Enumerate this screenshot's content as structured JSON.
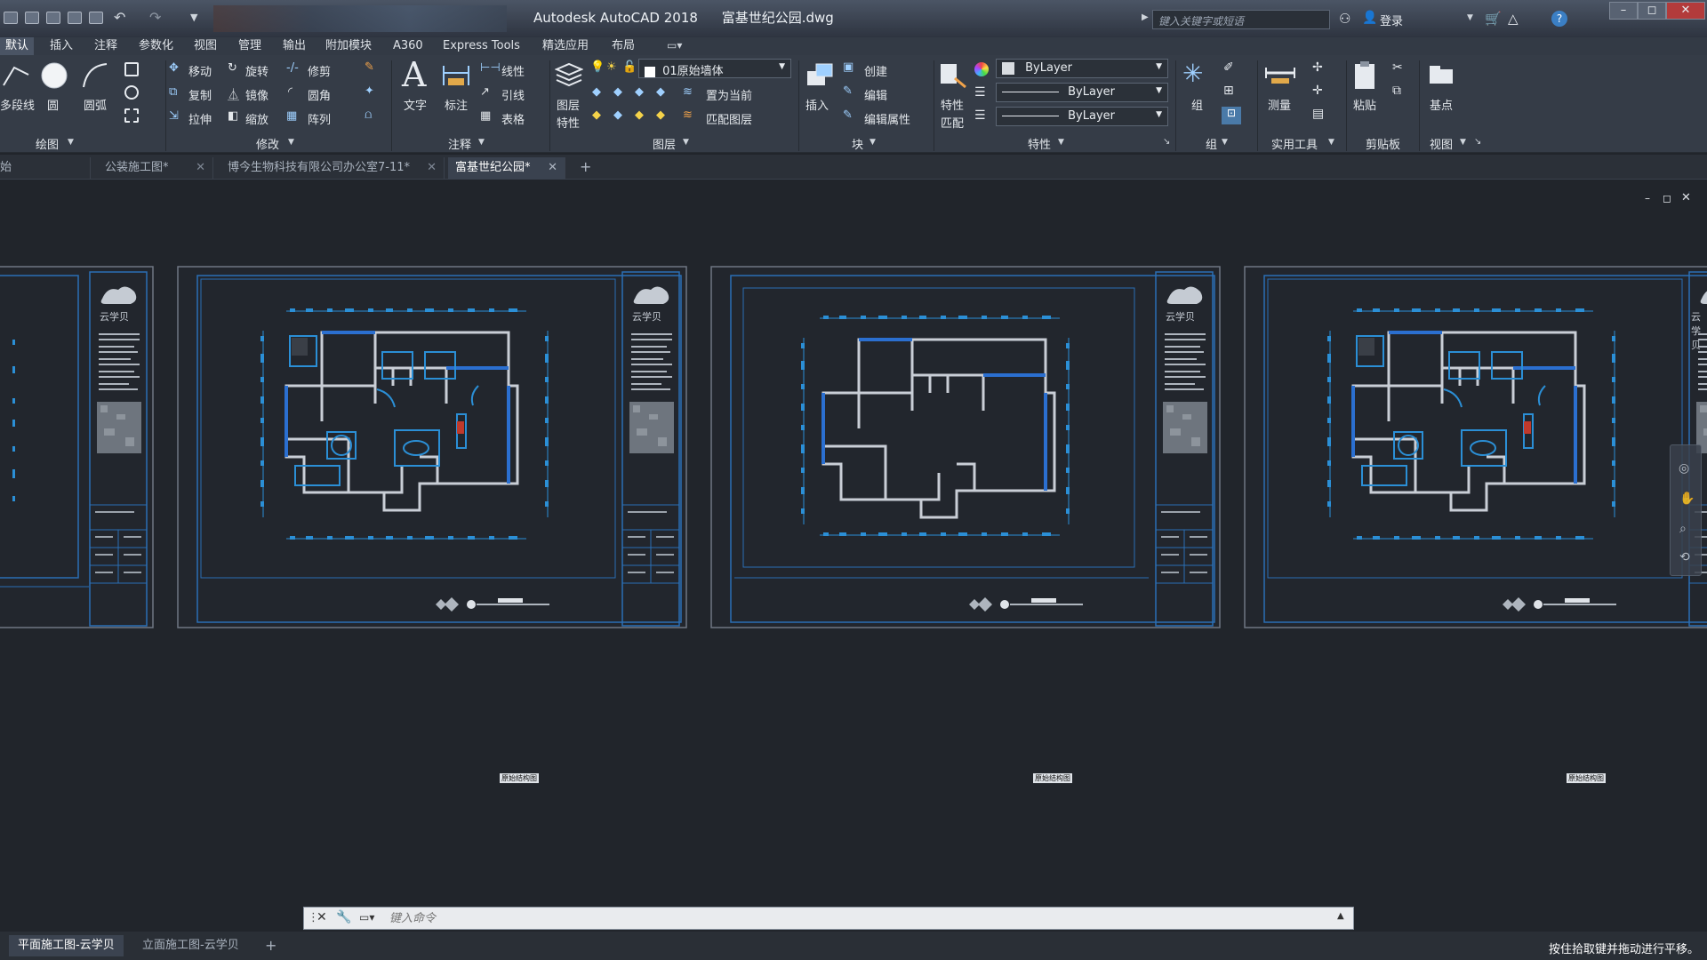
{
  "title_bar": {
    "app_title": "Autodesk AutoCAD 2018",
    "file_name": "富基世纪公园.dwg",
    "search_placeholder": "键入关键字或短语",
    "login_label": "登录"
  },
  "ribbon_tabs": [
    {
      "label": "默认",
      "active": true
    },
    {
      "label": "插入",
      "active": false
    },
    {
      "label": "注释",
      "active": false
    },
    {
      "label": "参数化",
      "active": false
    },
    {
      "label": "视图",
      "active": false
    },
    {
      "label": "管理",
      "active": false
    },
    {
      "label": "输出",
      "active": false
    },
    {
      "label": "附加模块",
      "active": false
    },
    {
      "label": "A360",
      "active": false
    },
    {
      "label": "Express Tools",
      "active": false
    },
    {
      "label": "精选应用",
      "active": false
    },
    {
      "label": "布局",
      "active": false
    }
  ],
  "ribbon": {
    "draw": {
      "polyline": "多段线",
      "circle": "圆",
      "arc": "圆弧",
      "panel": "绘图"
    },
    "modify": {
      "move": "移动",
      "rotate": "旋转",
      "trim": "修剪",
      "copy": "复制",
      "mirror": "镜像",
      "fillet": "圆角",
      "stretch": "拉伸",
      "scale": "缩放",
      "array": "阵列",
      "panel": "修改"
    },
    "annotation": {
      "text": "文字",
      "dimension": "标注",
      "linear": "线性",
      "leader": "引线",
      "table": "表格",
      "panel": "注释"
    },
    "layers": {
      "layer_props_1": "图层",
      "layer_props_2": "特性",
      "current_layer": "01原始墙体",
      "set_current": "置为当前",
      "match_layer": "匹配图层",
      "panel": "图层"
    },
    "block": {
      "insert": "插入",
      "create": "创建",
      "edit": "编辑",
      "edit_attr": "编辑属性",
      "panel": "块"
    },
    "properties": {
      "match_1": "特性",
      "match_2": "匹配",
      "color": "ByLayer",
      "linetype": "ByLayer",
      "lineweight": "ByLayer",
      "panel": "特性"
    },
    "groups": {
      "group": "组",
      "panel": "组"
    },
    "utilities": {
      "measure": "测量",
      "panel": "实用工具"
    },
    "clipboard": {
      "paste": "粘贴",
      "panel": "剪贴板"
    },
    "view": {
      "base": "基点",
      "panel": "视图"
    }
  },
  "doc_tabs": [
    {
      "label": "始",
      "active": false
    },
    {
      "label": "公装施工图*",
      "active": false
    },
    {
      "label": "博今生物科技有限公司办公室7-11*",
      "active": false
    },
    {
      "label": "富基世纪公园*",
      "active": true
    }
  ],
  "sheets": {
    "logo_text": "云学贝",
    "title_label": "原始结构图",
    "brand": "云学贝"
  },
  "command_line": {
    "placeholder": "键入命令"
  },
  "layout_tabs": [
    {
      "label": "平面施工图-云学贝",
      "active": true
    },
    {
      "label": "立面施工图-云学贝",
      "active": false
    }
  ],
  "status_message": "按住拾取键并拖动进行平移。",
  "colors": {
    "accent_blue": "#1f8fd4",
    "sheet_border": "#2a6fb5",
    "canvas": "#21252b"
  }
}
